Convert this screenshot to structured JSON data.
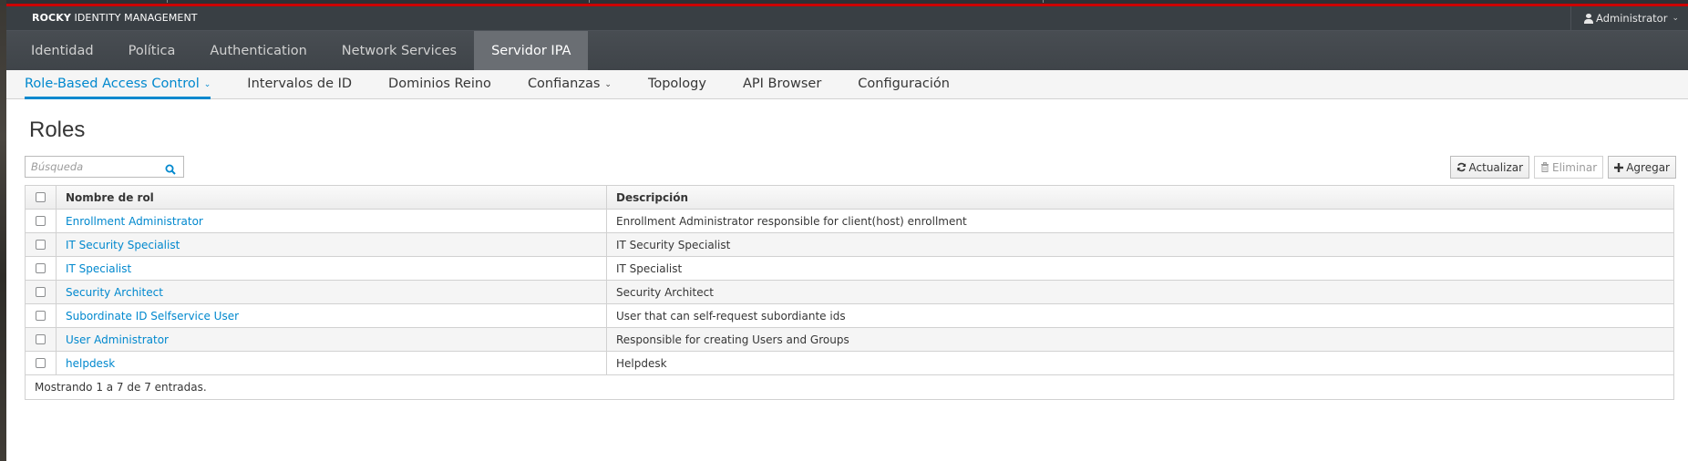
{
  "header": {
    "brand_bold": "ROCKY",
    "brand_rest": " IDENTITY MANAGEMENT",
    "user": "Administrator"
  },
  "main_nav": [
    {
      "label": "Identidad",
      "active": false
    },
    {
      "label": "Política",
      "active": false
    },
    {
      "label": "Authentication",
      "active": false
    },
    {
      "label": "Network Services",
      "active": false
    },
    {
      "label": "Servidor IPA",
      "active": true
    }
  ],
  "sub_nav": [
    {
      "label": "Role-Based Access Control",
      "active": true,
      "dropdown": true
    },
    {
      "label": "Intervalos de ID",
      "active": false,
      "dropdown": false
    },
    {
      "label": "Dominios Reino",
      "active": false,
      "dropdown": false
    },
    {
      "label": "Confianzas",
      "active": false,
      "dropdown": true
    },
    {
      "label": "Topology",
      "active": false,
      "dropdown": false
    },
    {
      "label": "API Browser",
      "active": false,
      "dropdown": false
    },
    {
      "label": "Configuración",
      "active": false,
      "dropdown": false
    }
  ],
  "page": {
    "title": "Roles",
    "search": {
      "placeholder": "Búsqueda",
      "value": ""
    },
    "buttons": {
      "refresh": "Actualizar",
      "delete": "Eliminar",
      "add": "Agregar"
    }
  },
  "table": {
    "columns": [
      "Nombre de rol",
      "Descripción"
    ],
    "rows": [
      {
        "name": "Enrollment Administrator",
        "description": "Enrollment Administrator responsible for client(host) enrollment"
      },
      {
        "name": "IT Security Specialist",
        "description": "IT Security Specialist"
      },
      {
        "name": "IT Specialist",
        "description": "IT Specialist"
      },
      {
        "name": "Security Architect",
        "description": "Security Architect"
      },
      {
        "name": "Subordinate ID Selfservice User",
        "description": "User that can self-request subordiante ids"
      },
      {
        "name": "User Administrator",
        "description": "Responsible for creating Users and Groups"
      },
      {
        "name": "helpdesk",
        "description": "Helpdesk"
      }
    ],
    "footer": "Mostrando 1 a 7 de 7 entradas."
  },
  "colors": {
    "accent": "#0088ce",
    "header_bg": "#393f44",
    "nav_active_bg": "#6a6e73",
    "top_stripe": "#cc0000"
  }
}
